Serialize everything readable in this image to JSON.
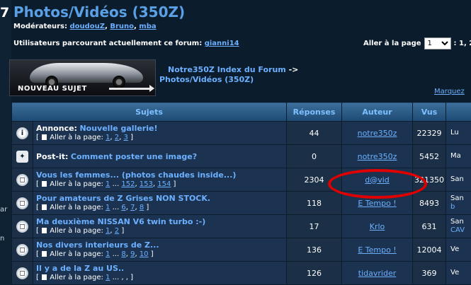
{
  "left_strip": {
    "number": "7",
    "texts": [
      "ar",
      "n"
    ]
  },
  "page_title": "Photos/Vidéos (350Z)",
  "moderators": {
    "label": "Modérateurs:",
    "names": [
      "doudouZ",
      "Bruno",
      "mba"
    ]
  },
  "browsing": {
    "label": "Utilisateurs parcourant actuellement ce forum:",
    "user": "gianni14"
  },
  "goto_page": {
    "label": "Aller à la page",
    "selected": "1",
    "suffix": ": 1, 2"
  },
  "new_topic_button": {
    "label": "NOUVEAU SUJET"
  },
  "breadcrumb": {
    "index": "Notre350Z Index du Forum",
    "arrow": "->",
    "forum": "Photos/Vidéos (350Z)"
  },
  "mark_all": "Marquez",
  "columns": {
    "subjects": "Sujets",
    "replies": "Réponses",
    "author": "Auteur",
    "views": "Vus"
  },
  "topics": [
    {
      "icon": "i",
      "prefix": "Annonce:",
      "title": "Nouvelle gallerie!",
      "pages_label": "Aller à la page:",
      "pages": [
        "1",
        "2",
        "3"
      ],
      "replies": "44",
      "author": "notre350z",
      "views": "22329",
      "last": [
        "Lu",
        ""
      ]
    },
    {
      "icon": "pin",
      "prefix": "Post-it:",
      "title": "Comment poster une image?",
      "pages_label": "",
      "pages": [],
      "replies": "0",
      "author": "notre350z",
      "views": "5452",
      "last": [
        "Ma",
        ""
      ]
    },
    {
      "icon": "n",
      "prefix": "",
      "title": "Vous les femmes... (photos chaudes inside...)",
      "pages_label": "Aller à la page:",
      "pages": [
        "1",
        "...",
        "152",
        "153",
        "154"
      ],
      "replies": "2304",
      "author": "d@vid",
      "views": "321350",
      "last": [
        "San",
        ""
      ]
    },
    {
      "icon": "n",
      "prefix": "",
      "title": "Pour amateurs de Z Grises NON STOCK.",
      "pages_label": "Aller à la page:",
      "pages": [
        "1",
        "...",
        "6",
        "7",
        "8"
      ],
      "replies": "118",
      "author": "E Tempo !",
      "views": "8493",
      "last": [
        "San",
        "b"
      ]
    },
    {
      "icon": "n",
      "prefix": "",
      "title": "Ma deuxième NISSAN V6 twin turbo :-)",
      "pages_label": "Aller à la page:",
      "pages": [
        "1",
        "2"
      ],
      "replies": "17",
      "author": "Krlo",
      "views": "631",
      "last": [
        "San",
        "CAV"
      ]
    },
    {
      "icon": "n",
      "prefix": "",
      "title": "Nos divers interieurs de Z...",
      "pages_label": "Aller à la page:",
      "pages": [
        "1",
        "...",
        "8",
        "9",
        "10"
      ],
      "replies": "136",
      "author": "E Tempo !",
      "views": "12004",
      "last": [
        "Ve",
        ""
      ]
    },
    {
      "icon": "n",
      "prefix": "",
      "title": "Il y a de la Z au US..",
      "pages_label": "Aller à la page:",
      "pages": [
        "1",
        "...",
        "",
        "",
        ""
      ],
      "replies": "126",
      "author": "tidavrider",
      "views": "369",
      "last": [
        "Ve",
        ""
      ]
    }
  ],
  "colors": {
    "link": "#6cb0ff",
    "title": "#5aa0e6",
    "highlight_ring": "#e00000",
    "background": "#0b1c2c"
  }
}
